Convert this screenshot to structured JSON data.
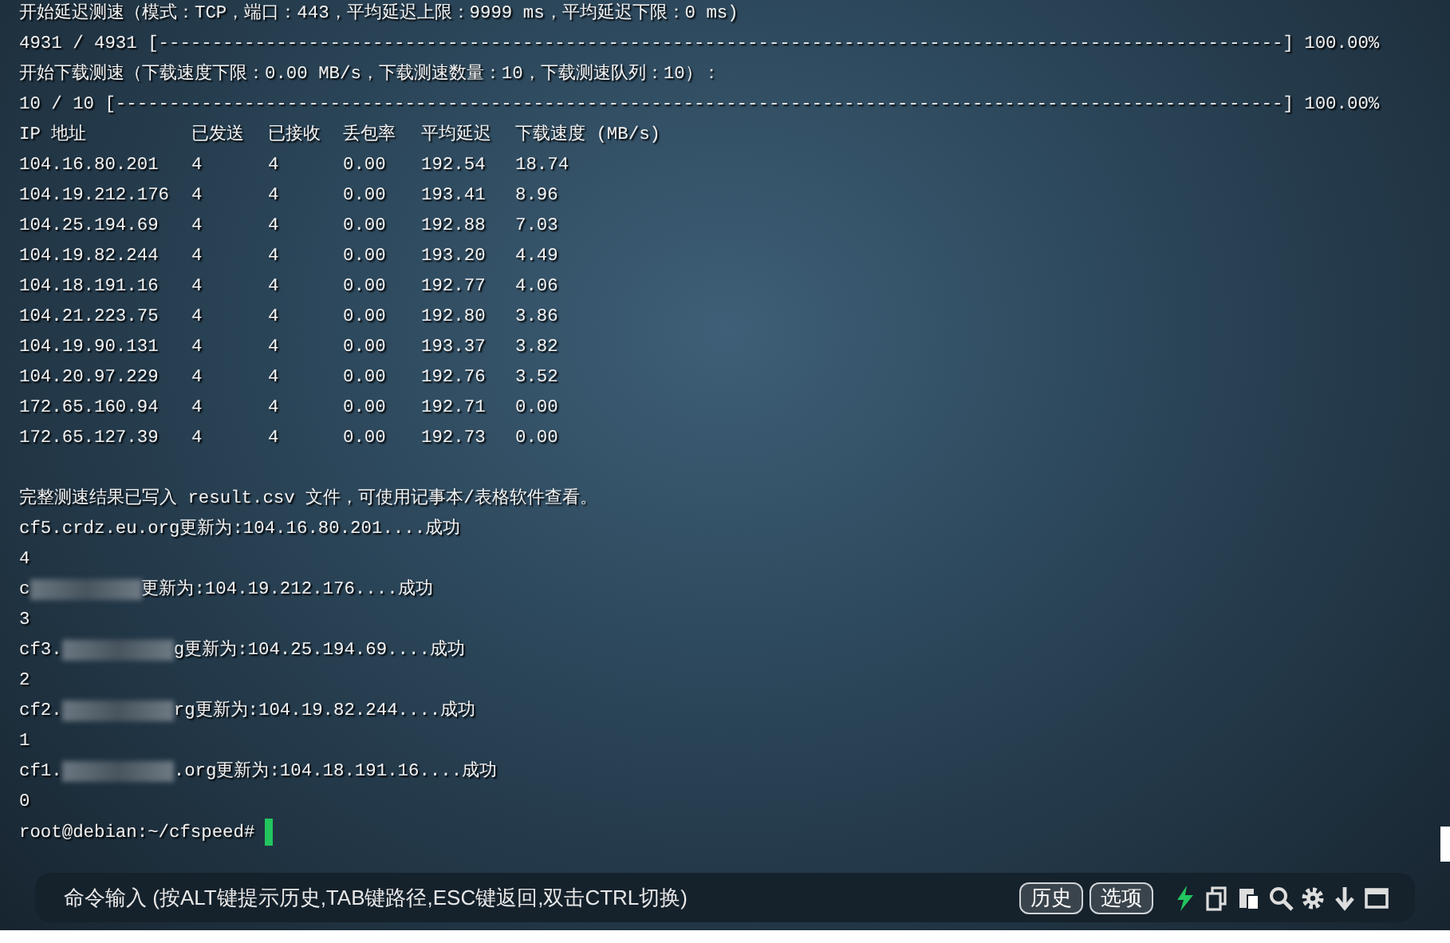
{
  "terminal": {
    "lines": [
      {
        "kind": "text",
        "text": "开始延迟测速（模式：TCP，端口：443，平均延迟上限：9999 ms，平均延迟下限：0 ms)"
      },
      {
        "kind": "text",
        "text": "4931 / 4931 [---------------------------------------------------------------------------------------------------------] 100.00%"
      },
      {
        "kind": "text",
        "text": "开始下载测速（下载速度下限：0.00 MB/s，下载测速数量：10，下载测速队列：10）："
      },
      {
        "kind": "text",
        "text": "10 / 10 [-------------------------------------------------------------------------------------------------------------] 100.00%"
      }
    ],
    "table": {
      "columns": [
        "IP 地址",
        "已发送",
        "已接收",
        "丢包率",
        "平均延迟",
        "下载速度 (MB/s)"
      ],
      "rows": [
        [
          "104.16.80.201",
          "4",
          "4",
          "0.00",
          "192.54",
          "18.74"
        ],
        [
          "104.19.212.176",
          "4",
          "4",
          "0.00",
          "193.41",
          "8.96"
        ],
        [
          "104.25.194.69",
          "4",
          "4",
          "0.00",
          "192.88",
          "7.03"
        ],
        [
          "104.19.82.244",
          "4",
          "4",
          "0.00",
          "193.20",
          "4.49"
        ],
        [
          "104.18.191.16",
          "4",
          "4",
          "0.00",
          "192.77",
          "4.06"
        ],
        [
          "104.21.223.75",
          "4",
          "4",
          "0.00",
          "192.80",
          "3.86"
        ],
        [
          "104.19.90.131",
          "4",
          "4",
          "0.00",
          "193.37",
          "3.82"
        ],
        [
          "104.20.97.229",
          "4",
          "4",
          "0.00",
          "192.76",
          "3.52"
        ],
        [
          "172.65.160.94",
          "4",
          "4",
          "0.00",
          "192.71",
          "0.00"
        ],
        [
          "172.65.127.39",
          "4",
          "4",
          "0.00",
          "192.73",
          "0.00"
        ]
      ]
    },
    "result_note": "完整测速结果已写入 result.csv 文件，可使用记事本/表格软件查看。",
    "updates": [
      {
        "prefix": "cf5.crdz.eu.org更新为:104.16.80.201....成功",
        "redacted": false,
        "countdown": "4"
      },
      {
        "prefix": "c",
        "redacted": true,
        "suffix": "更新为:104.19.212.176....成功",
        "countdown": "3"
      },
      {
        "prefix": "cf3.",
        "redacted": true,
        "suffix": "g更新为:104.25.194.69....成功",
        "countdown": "2"
      },
      {
        "prefix": "cf2.",
        "redacted": true,
        "suffix": "rg更新为:104.19.82.244....成功",
        "countdown": "1"
      },
      {
        "prefix": "cf1.",
        "redacted": true,
        "suffix": ".org更新为:104.18.191.16....成功",
        "countdown": "0"
      }
    ],
    "prompt": "root@debian:~/cfspeed#"
  },
  "command_bar": {
    "placeholder": "命令输入 (按ALT键提示历史,TAB键路径,ESC键返回,双击CTRL切换)",
    "buttons": [
      "历史",
      "选项"
    ]
  }
}
